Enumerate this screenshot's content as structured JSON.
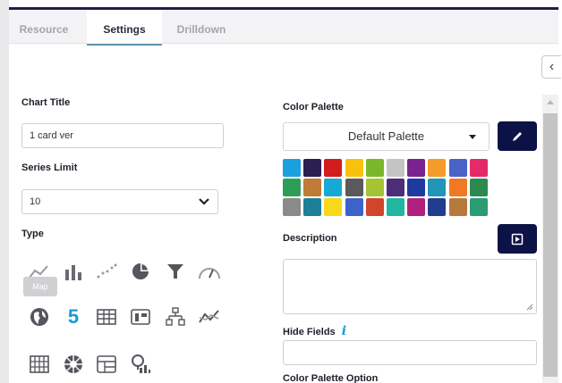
{
  "tabs": [
    {
      "label": "Resource",
      "active": false
    },
    {
      "label": "Settings",
      "active": true
    },
    {
      "label": "Drilldown",
      "active": false
    }
  ],
  "left": {
    "chart_title_label": "Chart Title",
    "chart_title_value": "1 card ver",
    "series_limit_label": "Series Limit",
    "series_limit_value": "10",
    "type_label": "Type",
    "tooltip": "Map",
    "types": [
      {
        "icon": "line-chart-icon"
      },
      {
        "icon": "bar-chart-icon"
      },
      {
        "icon": "scatter-chart-icon"
      },
      {
        "icon": "pie-chart-icon"
      },
      {
        "icon": "funnel-chart-icon"
      },
      {
        "icon": "gauge-chart-icon"
      },
      {
        "icon": "map-chart-icon"
      },
      {
        "icon": "number-card-icon",
        "glyph": "5"
      },
      {
        "icon": "table-chart-icon"
      },
      {
        "icon": "card-chart-icon"
      },
      {
        "icon": "tree-chart-icon"
      },
      {
        "icon": "trend-chart-icon"
      },
      {
        "icon": "grid-chart-icon"
      },
      {
        "icon": "sunburst-chart-icon"
      },
      {
        "icon": "pivot-chart-icon"
      },
      {
        "icon": "search-chart-icon"
      }
    ]
  },
  "right": {
    "color_palette_label": "Color Palette",
    "palette_value": "Default Palette",
    "description_label": "Description",
    "hide_fields_label": "Hide Fields",
    "color_palette_option_label": "Color Palette Option",
    "swatches": [
      [
        "#1aa0e0",
        "#2a1f4f",
        "#d21d1d",
        "#f8c20b",
        "#79b82a",
        "#c4c4c4",
        "#7a238f",
        "#f39c29",
        "#4a63c7",
        "#e52a6b"
      ],
      [
        "#2e9e56",
        "#c07b39",
        "#16a9d6",
        "#5a5a5a",
        "#a5c434",
        "#4d2d78",
        "#1f3a9f",
        "#2196b8",
        "#f07a24",
        "#2d8a4e"
      ],
      [
        "#8a8a8a",
        "#1d7f98",
        "#f9d81c",
        "#3e63c8",
        "#d1452c",
        "#22b5a0",
        "#b0207e",
        "#213d8f",
        "#b7793a",
        "#2a9b73"
      ]
    ]
  }
}
